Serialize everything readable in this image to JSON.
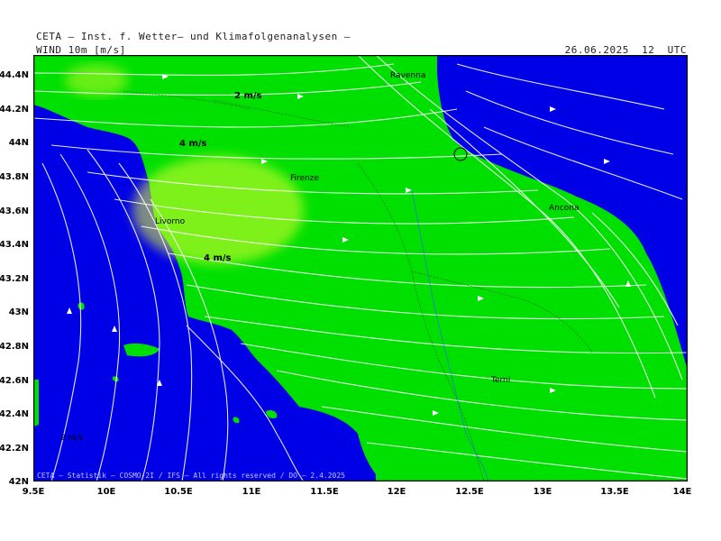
{
  "header": {
    "institution": "CETA – Inst. f. Wetter– und Klimafolgenanalysen –",
    "field_label": "WIND_10m_[m/s]",
    "datetime": "26.06.2025  12  UTC"
  },
  "axes": {
    "lat_ticks": [
      "44.4N",
      "44.2N",
      "44N",
      "43.8N",
      "43.6N",
      "43.4N",
      "43.2N",
      "43N",
      "42.8N",
      "42.6N",
      "42.4N",
      "42.2N",
      "42N"
    ],
    "lon_ticks": [
      "9.5E",
      "10E",
      "10.5E",
      "11E",
      "11.5E",
      "12E",
      "12.5E",
      "13E",
      "13.5E",
      "14E"
    ],
    "lat_range": [
      42,
      44.5
    ],
    "lon_range": [
      9.5,
      14
    ]
  },
  "map": {
    "speed_labels": [
      "2 m/s",
      "4 m/s",
      "4 m/s",
      "2 m/s"
    ],
    "cities": [
      "Ravenna",
      "Firenze",
      "Livorno",
      "Ancona",
      "Terni"
    ],
    "footer_note": "CETA – Statistik – COSMO-2I / IFS – All rights reserved / DO – 2.4.2025",
    "colors": {
      "low_wind": "#0000e6",
      "mid_wind": "#00e000",
      "high_wind": "#e6ff30",
      "streamlines": "#ffffff",
      "borders": "#333333"
    }
  }
}
